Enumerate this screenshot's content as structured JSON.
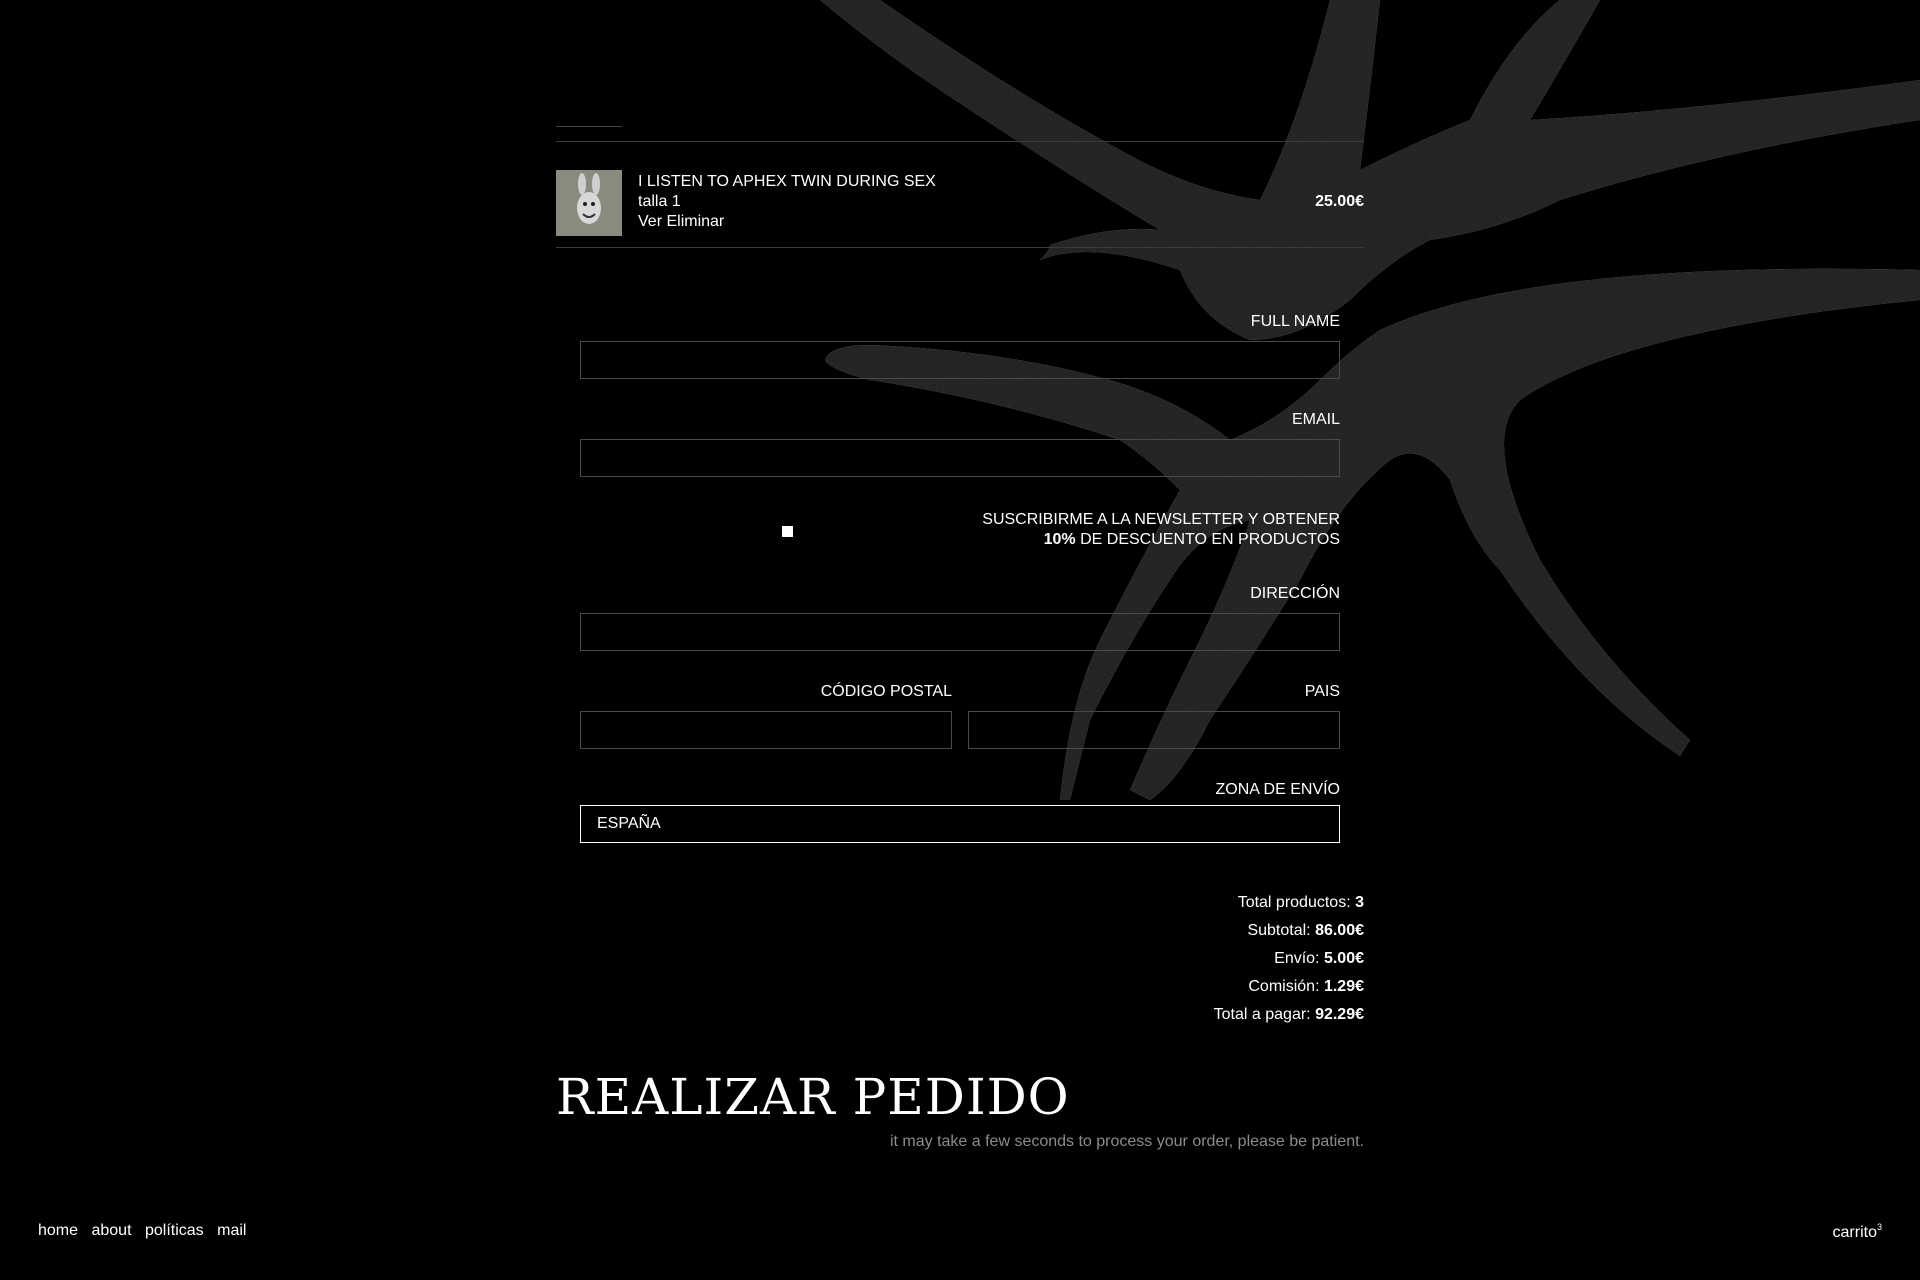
{
  "cart_item": {
    "name": "I LISTEN TO APHEX TWIN DURING SEX",
    "size": "talla 1",
    "view_label": "Ver",
    "remove_label": "Eliminar",
    "price": "25.00€"
  },
  "form": {
    "full_name_label": "FULL NAME",
    "full_name_value": "",
    "email_label": "EMAIL",
    "email_value": "",
    "newsletter_line1": "SUSCRIBIRME A LA NEWSLETTER Y OBTENER",
    "newsletter_discount": "10%",
    "newsletter_line2_rest": " DE DESCUENTO EN PRODUCTOS",
    "newsletter_checked": false,
    "address_label": "DIRECCIÓN",
    "address_value": "",
    "postal_label": "CÓDIGO POSTAL",
    "postal_value": "",
    "country_label": "PAIS",
    "country_value": "",
    "zone_label": "ZONA DE ENVÍO",
    "zone_value": "ESPAÑA"
  },
  "totals": {
    "products_label": "Total productos: ",
    "products_value": "3",
    "subtotal_label": "Subtotal: ",
    "subtotal_value": "86.00€",
    "shipping_label": "Envío: ",
    "shipping_value": "5.00€",
    "fee_label": "Comisión: ",
    "fee_value": "1.29€",
    "total_label": "Total a pagar: ",
    "total_value": "92.29€"
  },
  "checkout": {
    "button_label": "REALIZAR PEDIDO",
    "note": "it may take a few seconds to process your order, please be patient."
  },
  "footer": {
    "nav": [
      "home",
      "about",
      "políticas",
      "mail"
    ],
    "cart_label": "carrito",
    "cart_count": "3"
  },
  "colors": {
    "background": "#000000",
    "text": "#ffffff",
    "muted": "#8c8c8c",
    "art": "#2a2a2a"
  }
}
